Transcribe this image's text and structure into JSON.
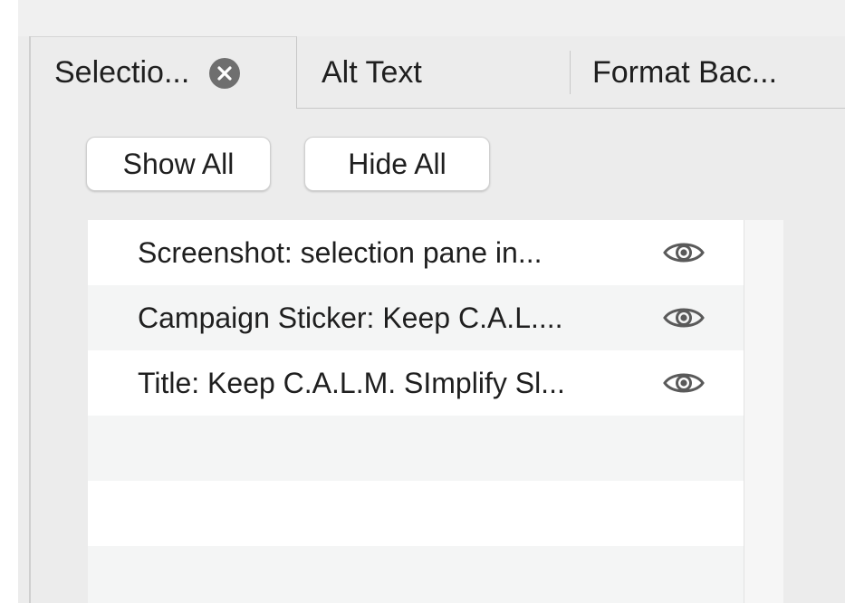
{
  "tabs": [
    {
      "label": "Selectio...",
      "active": true,
      "closable": true
    },
    {
      "label": "Alt Text",
      "active": false
    },
    {
      "label": "Format Bac...",
      "active": false
    }
  ],
  "buttons": {
    "show_all": "Show All",
    "hide_all": "Hide All"
  },
  "items": [
    {
      "label": "Screenshot: selection pane in...",
      "visibility_icon": "eye-icon"
    },
    {
      "label": "Campaign Sticker: Keep C.A.L....",
      "visibility_icon": "eye-icon"
    },
    {
      "label": "Title: Keep C.A.L.M. SImplify Sl...",
      "visibility_icon": "eye-icon"
    }
  ],
  "colors": {
    "pane_bg": "#ececec",
    "list_bg": "#ffffff",
    "list_alt_row": "#f4f5f5",
    "text": "#1f1f1f",
    "close_icon": "#6f6f6f",
    "eye_icon": "#5a5a5a"
  }
}
